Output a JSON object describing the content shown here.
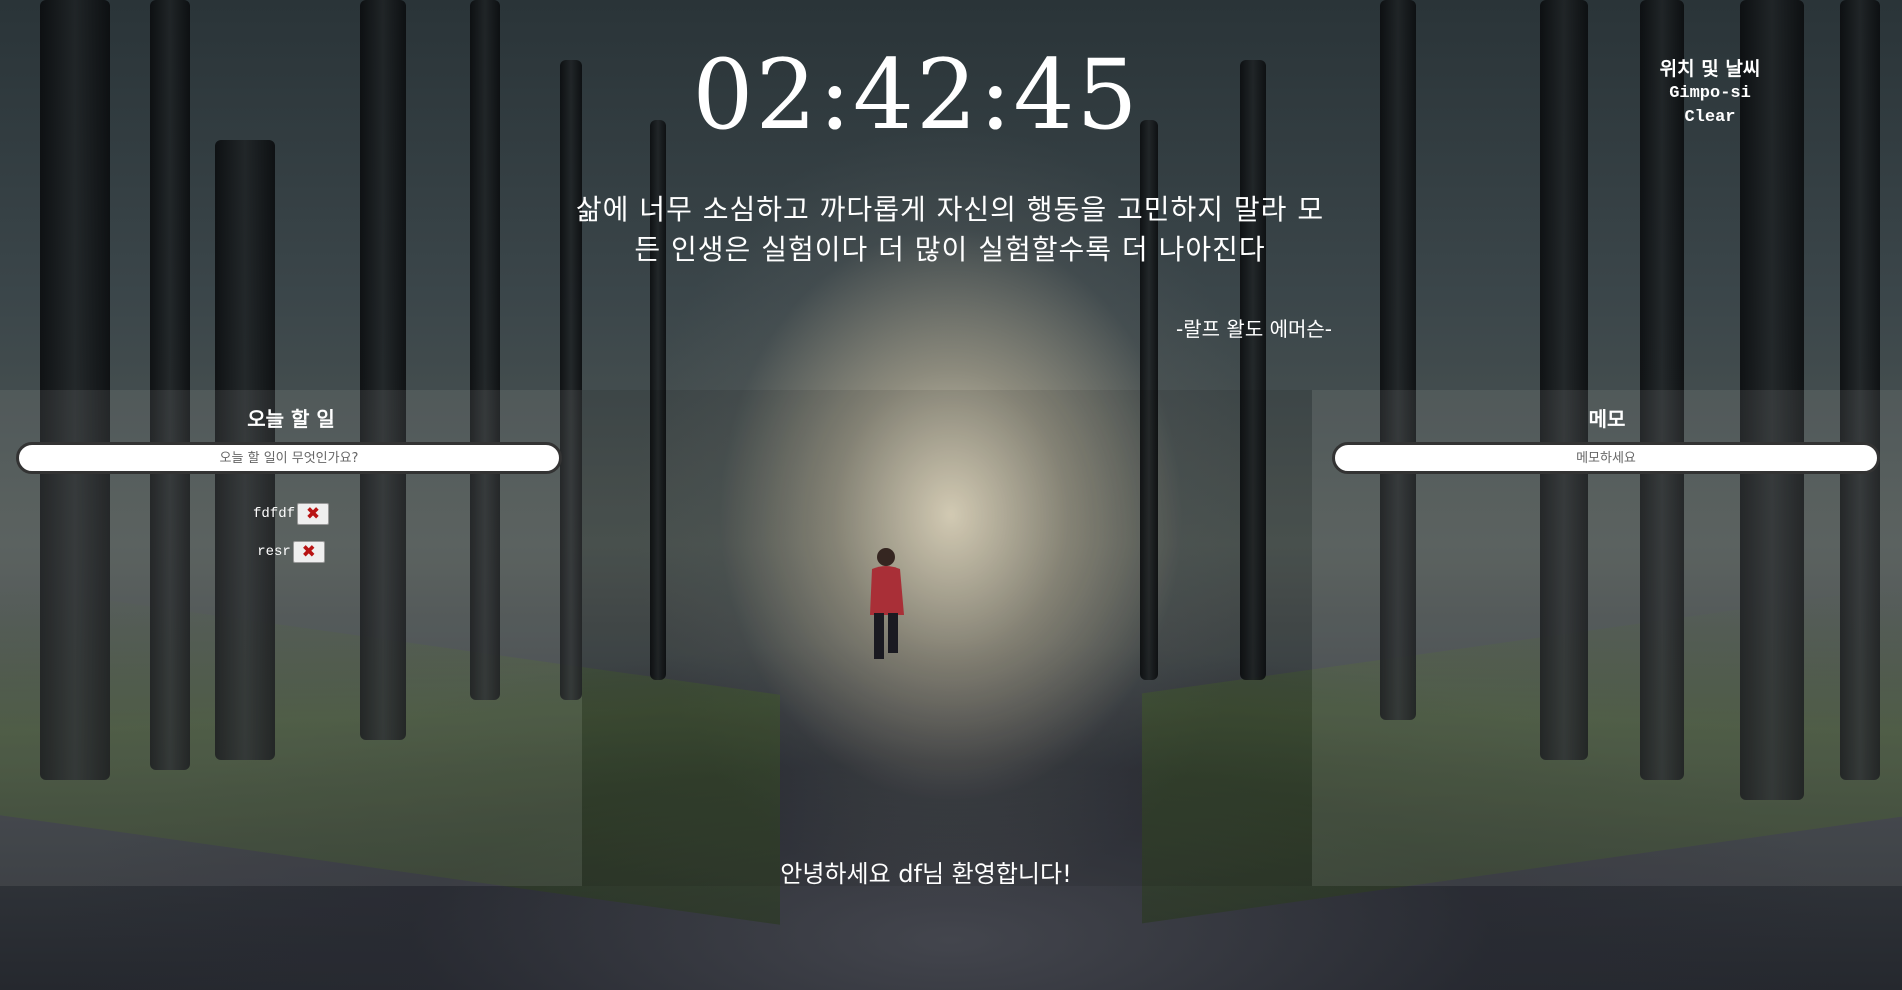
{
  "clock": {
    "time": "02:42:45"
  },
  "weather": {
    "title": "위치 및 날씨",
    "location": "Gimpo-si",
    "condition": "Clear"
  },
  "quote": {
    "text": "삶에 너무 소심하고 까다롭게 자신의 행동을 고민하지 말라 모든 인생은 실험이다 더 많이 실험할수록 더 나아진다",
    "author": "-랄프 왈도 에머슨-"
  },
  "todo": {
    "title": "오늘 할 일",
    "placeholder": "오늘 할 일이 무엇인가요?",
    "items": [
      {
        "text": "fdfdf",
        "delete_icon": "x-icon"
      },
      {
        "text": "resr",
        "delete_icon": "x-icon"
      }
    ]
  },
  "memo": {
    "title": "메모",
    "placeholder": "메모하세요"
  },
  "greeting": {
    "text": "안녕하세요 df님 환영합니다!"
  }
}
